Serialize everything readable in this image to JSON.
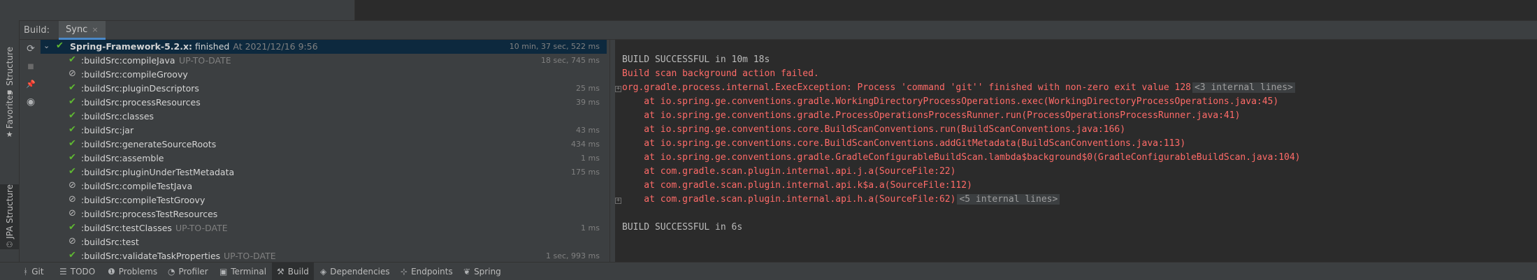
{
  "panel": {
    "title": "Build:",
    "tab_label": "Sync",
    "tab_close": "×"
  },
  "left_strip": [
    {
      "label": "Structure",
      "icon": "▪"
    },
    {
      "label": "Favorites",
      "icon": "★"
    },
    {
      "label": "JPA Structure",
      "icon": "⚇"
    }
  ],
  "tree_toolbar": [
    {
      "name": "resync-icon",
      "glyph": "⟳"
    },
    {
      "name": "stop-icon",
      "glyph": "■"
    },
    {
      "name": "pin-icon",
      "glyph": "📌"
    },
    {
      "name": "view-options-icon",
      "glyph": "◉"
    }
  ],
  "tree": {
    "root": {
      "name": "Spring-Framework-5.2.x:",
      "status": "finished",
      "time": "At 2021/12/16 9:56",
      "duration": "10 min, 37 sec, 522 ms"
    },
    "tasks": [
      {
        "label": ":buildSrc:compileJava",
        "hint": "UP-TO-DATE",
        "status": "ok",
        "duration": "18 sec, 745 ms"
      },
      {
        "label": ":buildSrc:compileGroovy",
        "hint": "",
        "status": "skip",
        "duration": ""
      },
      {
        "label": ":buildSrc:pluginDescriptors",
        "hint": "",
        "status": "ok",
        "duration": "25 ms"
      },
      {
        "label": ":buildSrc:processResources",
        "hint": "",
        "status": "ok",
        "duration": "39 ms"
      },
      {
        "label": ":buildSrc:classes",
        "hint": "",
        "status": "ok",
        "duration": ""
      },
      {
        "label": ":buildSrc:jar",
        "hint": "",
        "status": "ok",
        "duration": "43 ms"
      },
      {
        "label": ":buildSrc:generateSourceRoots",
        "hint": "",
        "status": "ok",
        "duration": "434 ms"
      },
      {
        "label": ":buildSrc:assemble",
        "hint": "",
        "status": "ok",
        "duration": "1 ms"
      },
      {
        "label": ":buildSrc:pluginUnderTestMetadata",
        "hint": "",
        "status": "ok",
        "duration": "175 ms"
      },
      {
        "label": ":buildSrc:compileTestJava",
        "hint": "",
        "status": "skip",
        "duration": ""
      },
      {
        "label": ":buildSrc:compileTestGroovy",
        "hint": "",
        "status": "skip",
        "duration": ""
      },
      {
        "label": ":buildSrc:processTestResources",
        "hint": "",
        "status": "skip",
        "duration": ""
      },
      {
        "label": ":buildSrc:testClasses",
        "hint": "UP-TO-DATE",
        "status": "ok",
        "duration": "1 ms"
      },
      {
        "label": ":buildSrc:test",
        "hint": "",
        "status": "skip",
        "duration": ""
      },
      {
        "label": ":buildSrc:validateTaskProperties",
        "hint": "UP-TO-DATE",
        "status": "ok",
        "duration": "1 sec, 993 ms"
      }
    ]
  },
  "console": [
    {
      "text": "",
      "type": "normal",
      "fold": false,
      "internal": ""
    },
    {
      "text": "BUILD SUCCESSFUL in 10m 18s",
      "type": "normal",
      "fold": false,
      "internal": ""
    },
    {
      "text": "Build scan background action failed.",
      "type": "err",
      "fold": false,
      "internal": ""
    },
    {
      "text": "org.gradle.process.internal.ExecException: Process 'command 'git'' finished with non-zero exit value 128",
      "type": "err",
      "fold": true,
      "internal": "<3 internal lines>"
    },
    {
      "text": "    at io.spring.ge.conventions.gradle.WorkingDirectoryProcessOperations.exec(WorkingDirectoryProcessOperations.java:45)",
      "type": "err",
      "fold": false,
      "internal": ""
    },
    {
      "text": "    at io.spring.ge.conventions.gradle.ProcessOperationsProcessRunner.run(ProcessOperationsProcessRunner.java:41)",
      "type": "err",
      "fold": false,
      "internal": ""
    },
    {
      "text": "    at io.spring.ge.conventions.core.BuildScanConventions.run(BuildScanConventions.java:166)",
      "type": "err",
      "fold": false,
      "internal": ""
    },
    {
      "text": "    at io.spring.ge.conventions.core.BuildScanConventions.addGitMetadata(BuildScanConventions.java:113)",
      "type": "err",
      "fold": false,
      "internal": ""
    },
    {
      "text": "    at io.spring.ge.conventions.gradle.GradleConfigurableBuildScan.lambda$background$0(GradleConfigurableBuildScan.java:104)",
      "type": "err",
      "fold": false,
      "internal": ""
    },
    {
      "text": "    at com.gradle.scan.plugin.internal.api.j.a(SourceFile:22)",
      "type": "err",
      "fold": false,
      "internal": ""
    },
    {
      "text": "    at com.gradle.scan.plugin.internal.api.k$a.a(SourceFile:112)",
      "type": "err",
      "fold": false,
      "internal": ""
    },
    {
      "text": "    at com.gradle.scan.plugin.internal.api.h.a(SourceFile:62)",
      "type": "err",
      "fold": true,
      "internal": "<5 internal lines>"
    },
    {
      "text": "",
      "type": "normal",
      "fold": false,
      "internal": ""
    },
    {
      "text": "BUILD SUCCESSFUL in 6s",
      "type": "normal",
      "fold": false,
      "internal": ""
    }
  ],
  "bottom_bar": [
    {
      "label": "Git",
      "icon": "ᚼ",
      "active": false
    },
    {
      "label": "TODO",
      "icon": "☰",
      "active": false
    },
    {
      "label": "Problems",
      "icon": "❶",
      "active": false
    },
    {
      "label": "Profiler",
      "icon": "◔",
      "active": false
    },
    {
      "label": "Terminal",
      "icon": "▣",
      "active": false
    },
    {
      "label": "Build",
      "icon": "⚒",
      "active": true
    },
    {
      "label": "Dependencies",
      "icon": "◈",
      "active": false
    },
    {
      "label": "Endpoints",
      "icon": "⊹",
      "active": false
    },
    {
      "label": "Spring",
      "icon": "❦",
      "active": false
    }
  ],
  "colors": {
    "success": "#5fb832",
    "error": "#ff6b68",
    "tab_accent": "#4a88c7"
  }
}
